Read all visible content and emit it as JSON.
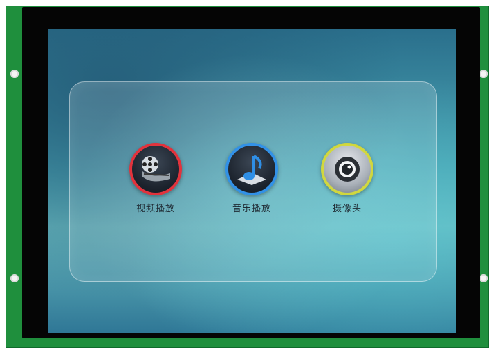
{
  "apps": [
    {
      "label": "视频播放",
      "icon": "film-reel-icon",
      "ring_color": "#e0303a"
    },
    {
      "label": "音乐播放",
      "icon": "music-note-icon",
      "ring_color": "#2f8fe6"
    },
    {
      "label": "摄像头",
      "icon": "camera-icon",
      "ring_color": "#cfd63b"
    }
  ]
}
